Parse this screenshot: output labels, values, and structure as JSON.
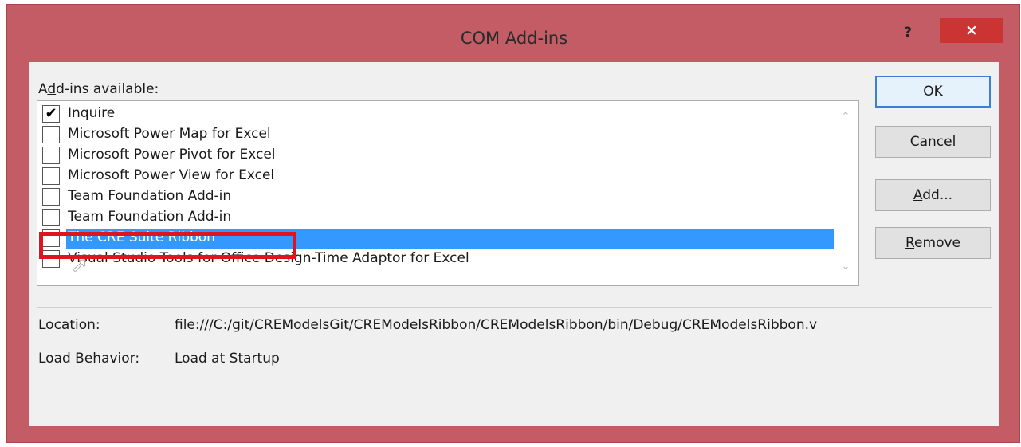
{
  "window": {
    "title": "COM Add-ins",
    "help_glyph": "?",
    "close_glyph": "×"
  },
  "addins": {
    "label_prefix": "A",
    "label_underlined": "d",
    "label_suffix": "d-ins available:",
    "items": [
      {
        "label": "Inquire",
        "checked": true,
        "selected": false
      },
      {
        "label": "Microsoft Power Map for Excel",
        "checked": false,
        "selected": false
      },
      {
        "label": "Microsoft Power Pivot for Excel",
        "checked": false,
        "selected": false
      },
      {
        "label": "Microsoft Power View for Excel",
        "checked": false,
        "selected": false
      },
      {
        "label": "Team Foundation Add-in",
        "checked": false,
        "selected": false
      },
      {
        "label": "Team Foundation Add-in",
        "checked": false,
        "selected": false
      },
      {
        "label": "The CRE Suite Ribbon",
        "checked": false,
        "selected": true
      },
      {
        "label": "Visual Studio Tools for Office Design-Time Adaptor for Excel",
        "checked": false,
        "selected": false
      }
    ]
  },
  "buttons": {
    "ok": "OK",
    "cancel": "Cancel",
    "add": "Add...",
    "remove": "Remove"
  },
  "details": {
    "location_label": "Location:",
    "location_value": "file:///C:/git/CREModelsGit/CREModelsRibbon/CREModelsRibbon/bin/Debug/CREModelsRibbon.v",
    "load_label": "Load Behavior:",
    "load_value": "Load at Startup"
  },
  "colors": {
    "title_bar": "#c45c66",
    "close_button": "#cc3434",
    "selection": "#3399ff",
    "annotation": "#e0141e"
  },
  "icons": {
    "check": "✔",
    "scroll_up": "⌃",
    "scroll_down": "⌄",
    "cursor": "arrow-pointer"
  }
}
